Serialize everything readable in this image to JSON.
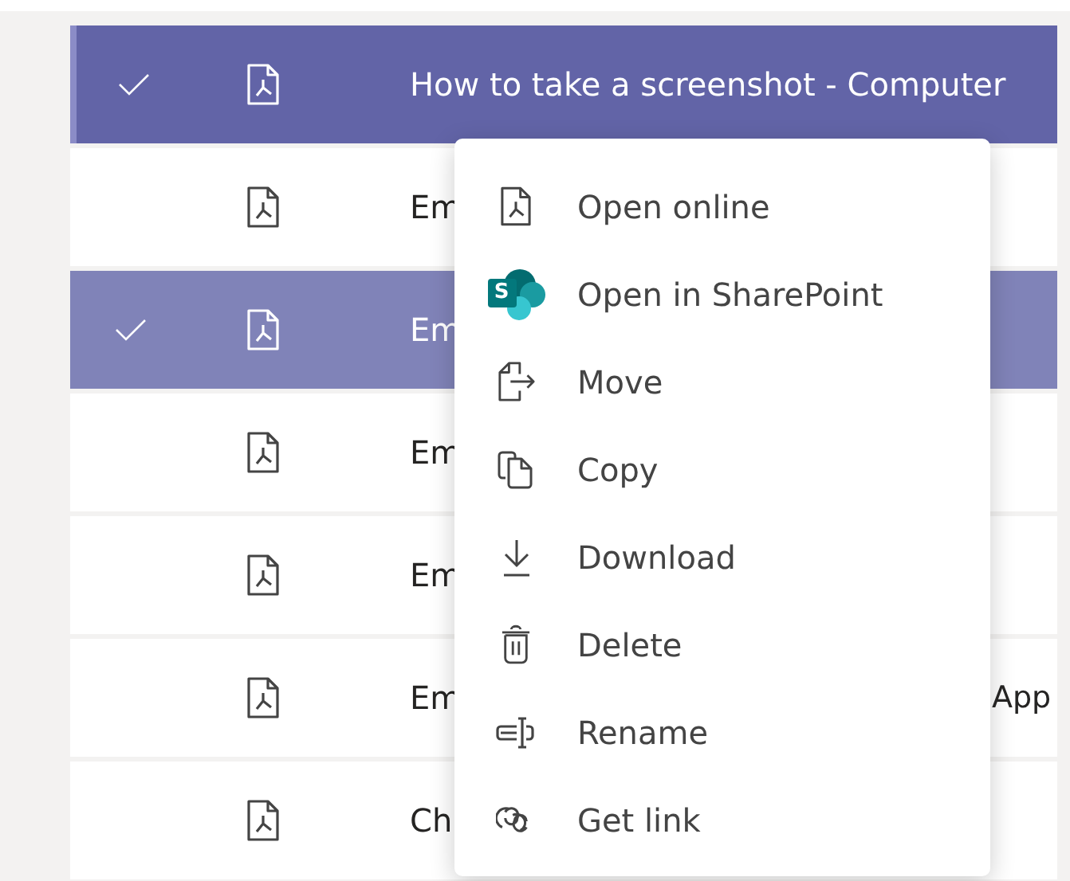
{
  "files": [
    {
      "name": "How to take a screenshot - Computer",
      "selected": true,
      "focused": true
    },
    {
      "name": "Em",
      "selected": false,
      "focused": false
    },
    {
      "name": "Em",
      "selected": true,
      "focused": false
    },
    {
      "name": "Em",
      "selected": false,
      "focused": false
    },
    {
      "name": "Em",
      "selected": false,
      "focused": false
    },
    {
      "name": "Em",
      "tail": "App",
      "selected": false,
      "focused": false
    },
    {
      "name": "Ch",
      "selected": false,
      "focused": false
    }
  ],
  "context_menu": {
    "items": [
      {
        "label": "Open online",
        "kind": "pdf"
      },
      {
        "label": "Open in SharePoint",
        "kind": "sharepoint",
        "logo_letter": "S"
      },
      {
        "label": "Move",
        "kind": "move"
      },
      {
        "label": "Copy",
        "kind": "copy"
      },
      {
        "label": "Download",
        "kind": "download"
      },
      {
        "label": "Delete",
        "kind": "delete"
      },
      {
        "label": "Rename",
        "kind": "rename"
      },
      {
        "label": "Get link",
        "kind": "link"
      }
    ]
  }
}
